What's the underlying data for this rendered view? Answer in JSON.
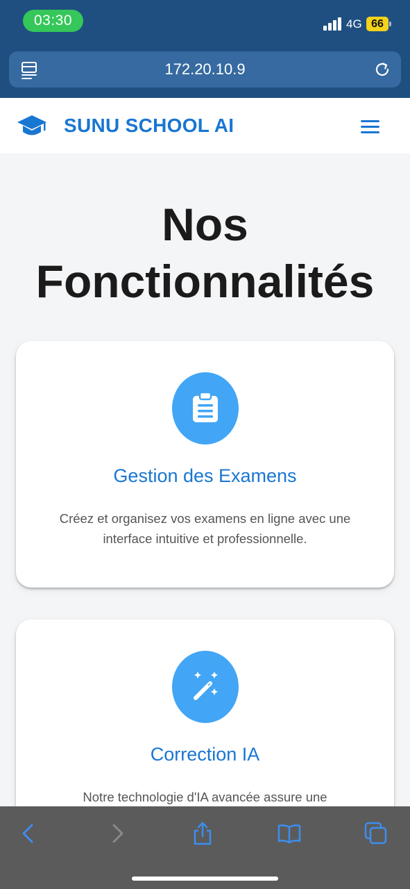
{
  "status_bar": {
    "time": "03:30",
    "network": "4G",
    "battery": "66",
    "colors": {
      "time_pill": "#35c759",
      "battery": "#f5d21b"
    }
  },
  "browser": {
    "url": "172.20.10.9",
    "icons": {
      "left": "page-menu-icon",
      "right": "reload-icon"
    }
  },
  "navbar": {
    "brand": "SUNU SCHOOL AI",
    "logo_icon": "graduation-cap-icon",
    "menu_icon": "hamburger-menu-icon",
    "accent_color": "#1976d2"
  },
  "main": {
    "title_line1": "Nos",
    "title_line2": "Fonctionnalités",
    "features": [
      {
        "icon": "clipboard-icon",
        "title": "Gestion des Examens",
        "description": "Créez et organisez vos examens en ligne avec une interface intuitive et professionnelle."
      },
      {
        "icon": "magic-wand-icon",
        "title": "Correction IA",
        "description": "Notre technologie d'IA avancée assure une"
      }
    ],
    "icon_circle_color": "#42a5f5"
  },
  "toolbar": {
    "icons": [
      "back-icon",
      "forward-icon",
      "share-icon",
      "bookmarks-icon",
      "tabs-icon"
    ],
    "tint": "#3d8ef0"
  }
}
